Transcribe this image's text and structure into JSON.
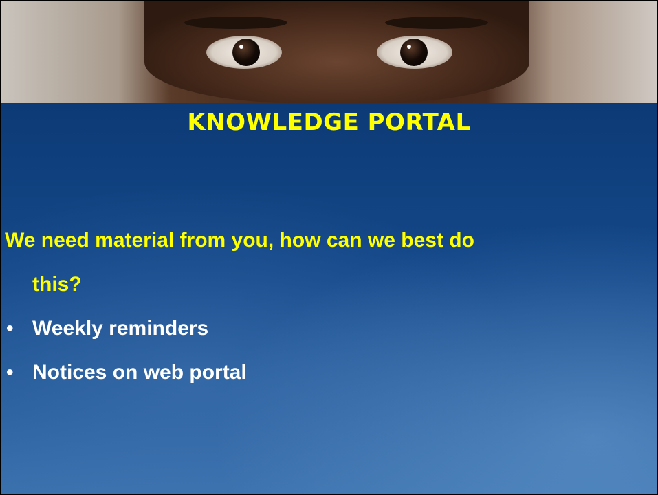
{
  "slide": {
    "title": "KNOWLEDGE PORTAL",
    "question_line1": "We need material from you, how can we best do",
    "question_line2": "this?",
    "bullets": [
      {
        "text": "Weekly reminders"
      },
      {
        "text": "Notices on web portal"
      }
    ],
    "bullet_glyph": "•"
  },
  "colors": {
    "title": "#ffff00",
    "question": "#ffff00",
    "bullet_text": "#ffffff",
    "background": "#0d3d7a"
  }
}
